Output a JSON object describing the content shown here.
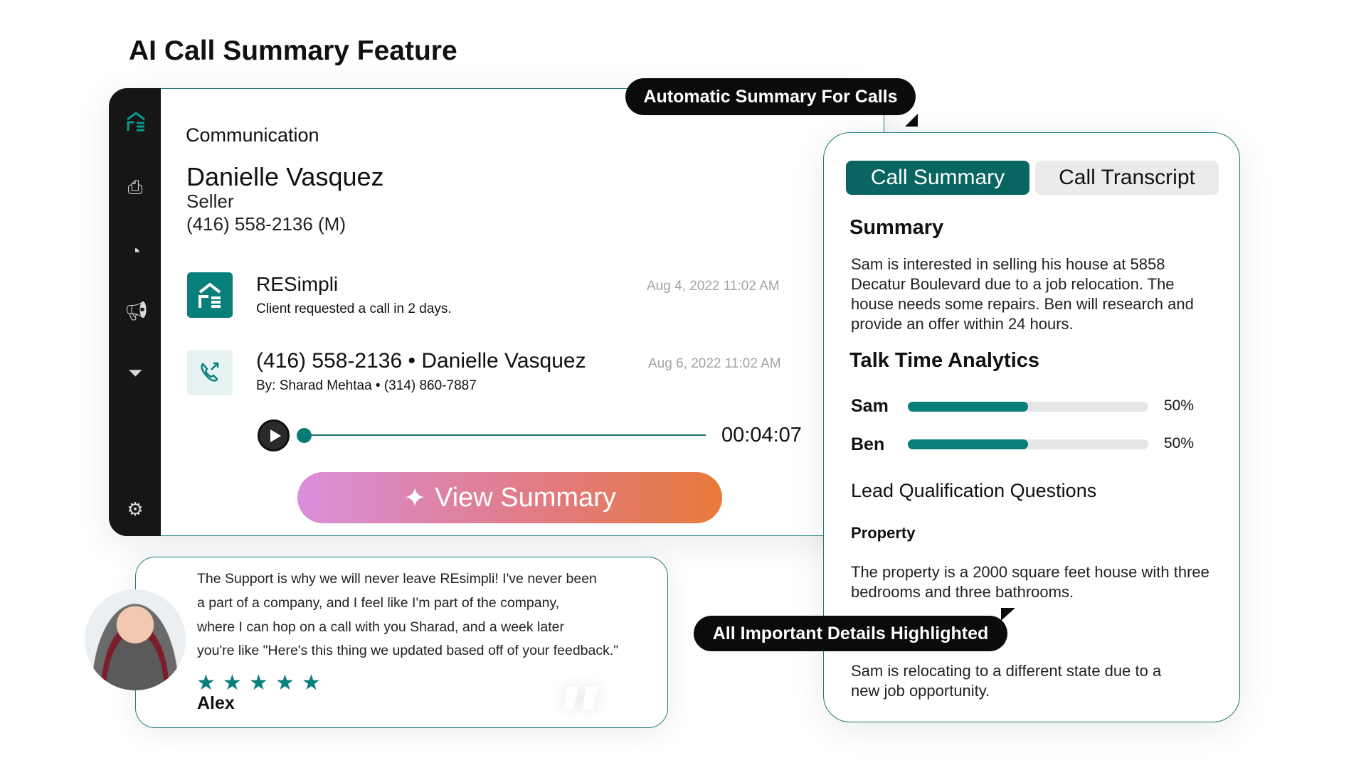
{
  "title": "AI Call Summary Feature",
  "sidebar": {
    "icons": [
      "resimpli-logo-icon",
      "inbox-icon",
      "chart-icon",
      "megaphone-icon",
      "funnel-icon",
      "gear-icon"
    ]
  },
  "communication": {
    "heading": "Communication",
    "contact": {
      "name": "Danielle Vasquez",
      "role": "Seller",
      "phone": "(416) 558-2136  (M)"
    },
    "items": [
      {
        "title": "RESimpli",
        "subtitle": "Client requested a call in 2 days.",
        "date": "Aug 4, 2022 11:02 AM",
        "icon": "resimpli-logo-icon"
      },
      {
        "title": "(416) 558-2136 • Danielle Vasquez",
        "subtitle": "By: Sharad Mehtaa • (314) 860-7887",
        "date": "Aug 6, 2022 11:02 AM",
        "icon": "phone-outgoing-icon"
      }
    ],
    "player": {
      "duration": "00:04:07",
      "progress": 0
    },
    "view_summary_label": "View Summary"
  },
  "callouts": {
    "automatic": "Automatic Summary For Calls",
    "highlighted": "All Important Details Highlighted"
  },
  "panel": {
    "tabs": [
      {
        "label": "Call Summary",
        "active": true
      },
      {
        "label": "Call Transcript",
        "active": false
      }
    ],
    "summary_heading": "Summary",
    "summary_text": "Sam is interested in selling his house at 5858 Decatur Boulevard due to a job relocation. The house needs some repairs. Ben will research and provide an offer within 24 hours.",
    "talk_heading": "Talk Time Analytics",
    "talk": [
      {
        "name": "Sam",
        "percent": 50,
        "label": "50%"
      },
      {
        "name": "Ben",
        "percent": 50,
        "label": "50%"
      }
    ],
    "lead_heading": "Lead Qualification Questions",
    "property_heading": "Property",
    "property_text": "The property is a 2000 square feet house with three bedrooms and three bathrooms.",
    "relocation_text": "Sam is relocating to a different state due to a new job opportunity."
  },
  "testimonial": {
    "lines": [
      "The Support is why we will never leave REsimpli! I've never been",
      "a part of a company, and I feel like I'm part of the company,",
      "where I can hop on a call with you Sharad, and a week later",
      "you're like \"Here's this thing we updated based off of your feedback.\""
    ],
    "rating": 5,
    "author": "Alex"
  },
  "colors": {
    "accent": "#087f7b",
    "dark": "#161616",
    "gradient_start": "#d98fdc",
    "gradient_end": "#e87a3a"
  }
}
